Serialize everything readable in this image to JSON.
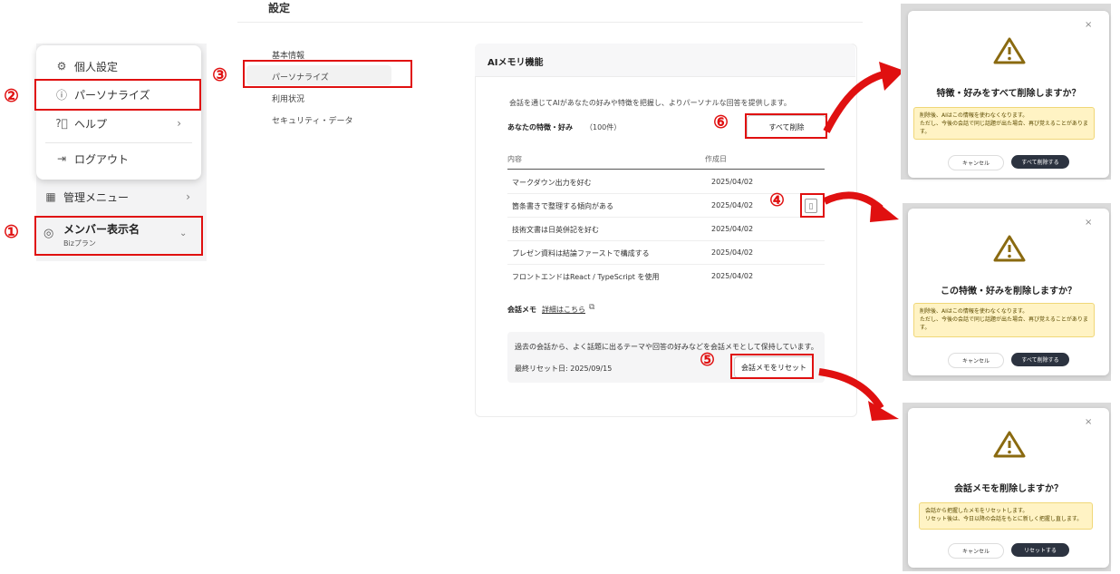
{
  "sidebar": {
    "menu": {
      "personal_settings": "個人設定",
      "personalize": "パーソナライズ",
      "help": "ヘルプ",
      "logout": "ログアウト"
    },
    "admin_menu": "管理メニュー",
    "member_name": "メンバー表示名",
    "plan": "Bizプラン"
  },
  "settings": {
    "title": "設定",
    "subnav": [
      "基本情報",
      "パーソナライズ",
      "利用状況",
      "セキュリティ・データ"
    ]
  },
  "panel": {
    "title": "AIメモリ機能",
    "description": "会話を通じてAIがあなたの好みや特徴を把握し、よりパーソナルな回答を提供します。",
    "traits_heading": "あなたの特徴・好み",
    "traits_count": "（100件）",
    "delete_all_label": "すべて削除",
    "col_content": "内容",
    "col_created": "作成日",
    "rows": [
      {
        "content": "マークダウン出力を好む",
        "date": "2025/04/02"
      },
      {
        "content": "箇条書きで整理する傾向がある",
        "date": "2025/04/02"
      },
      {
        "content": "技術文書は日英併記を好む",
        "date": "2025/04/02"
      },
      {
        "content": "プレゼン資料は結論ファーストで構成する",
        "date": "2025/04/02"
      },
      {
        "content": "フロントエンドはReact / TypeScript を使用",
        "date": "2025/04/02"
      }
    ],
    "memo_heading": "会話メモ",
    "memo_link": "詳細はこちら",
    "memo_desc": "過去の会話から、よく話題に出るテーマや回答の好みなどを会話メモとして保持しています。",
    "last_reset": "最終リセット日: 2025/09/15",
    "reset_label": "会話メモをリセット"
  },
  "annotations": [
    "①",
    "②",
    "③",
    "④",
    "⑤",
    "⑥"
  ],
  "dialogs": [
    {
      "title": "特徴・好みをすべて削除しますか？",
      "warn_line1": "削除後、AIはこの情報を使わなくなります。",
      "warn_line2": "ただし、今後の会話で同じ話題が出た場合、再び覚えることがありま",
      "warn_line3": "す。",
      "cancel": "キャンセル",
      "confirm": "すべて削除する"
    },
    {
      "title": "この特徴・好みを削除しますか？",
      "warn_line1": "削除後、AIはこの情報を使わなくなります。",
      "warn_line2": "ただし、今後の会話で同じ話題が出た場合、再び覚えることがありま",
      "warn_line3": "す。",
      "cancel": "キャンセル",
      "confirm": "すべて削除する"
    },
    {
      "title": "会話メモを削除しますか？",
      "warn_line1": "会話から把握したメモをリセットします。",
      "warn_line2": "リセット後は、今日以降の会話をもとに新しく把握し直します。",
      "warn_line3": "",
      "cancel": "キャンセル",
      "confirm": "リセットする"
    }
  ],
  "colors": {
    "annotation_red": "#e01010",
    "warning_icon": "#8a6a10",
    "warning_bg": "#fff3c4",
    "primary_dark": "#2c3340"
  }
}
